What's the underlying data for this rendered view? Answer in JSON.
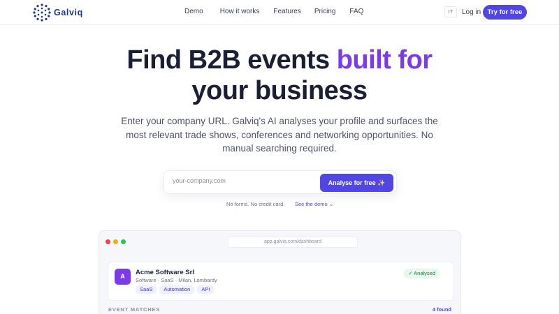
{
  "brand": {
    "name": "Galviq"
  },
  "nav": {
    "links": [
      "Demo",
      "How it works",
      "Features",
      "Pricing",
      "FAQ"
    ],
    "language": "IT",
    "login": "Log in",
    "cta": "Try for free"
  },
  "hero": {
    "title_line1_plain": "Find B2B events ",
    "title_line1_accent": "built for",
    "title_line2": "your business",
    "subtitle": "Enter your company URL. Galviq's AI analyses your profile and surfaces the most relevant trade shows, conferences and networking opportunities. No manual searching required."
  },
  "search": {
    "placeholder": "your-company.com",
    "button": "Analyse for free ✨",
    "hint": "No forms. No credit card.",
    "demo_link": "See the demo ⌄"
  },
  "dashboard": {
    "url": "app.galviq.com/dashboard",
    "company": {
      "initial": "A",
      "name": "Acme Software Srl",
      "meta": "Software · SaaS · Milan, Lombardy",
      "tags": [
        "SaaS",
        "Automation",
        "API"
      ],
      "status": "✓ Analysed"
    },
    "matches_label": "EVENT MATCHES",
    "matches_count": "4 found"
  },
  "colors": {
    "accent": "#4f46e5",
    "accent_text": "#7c3aed",
    "dot_red": "#ef4444",
    "dot_yellow": "#eab308",
    "dot_green": "#22c55e"
  }
}
